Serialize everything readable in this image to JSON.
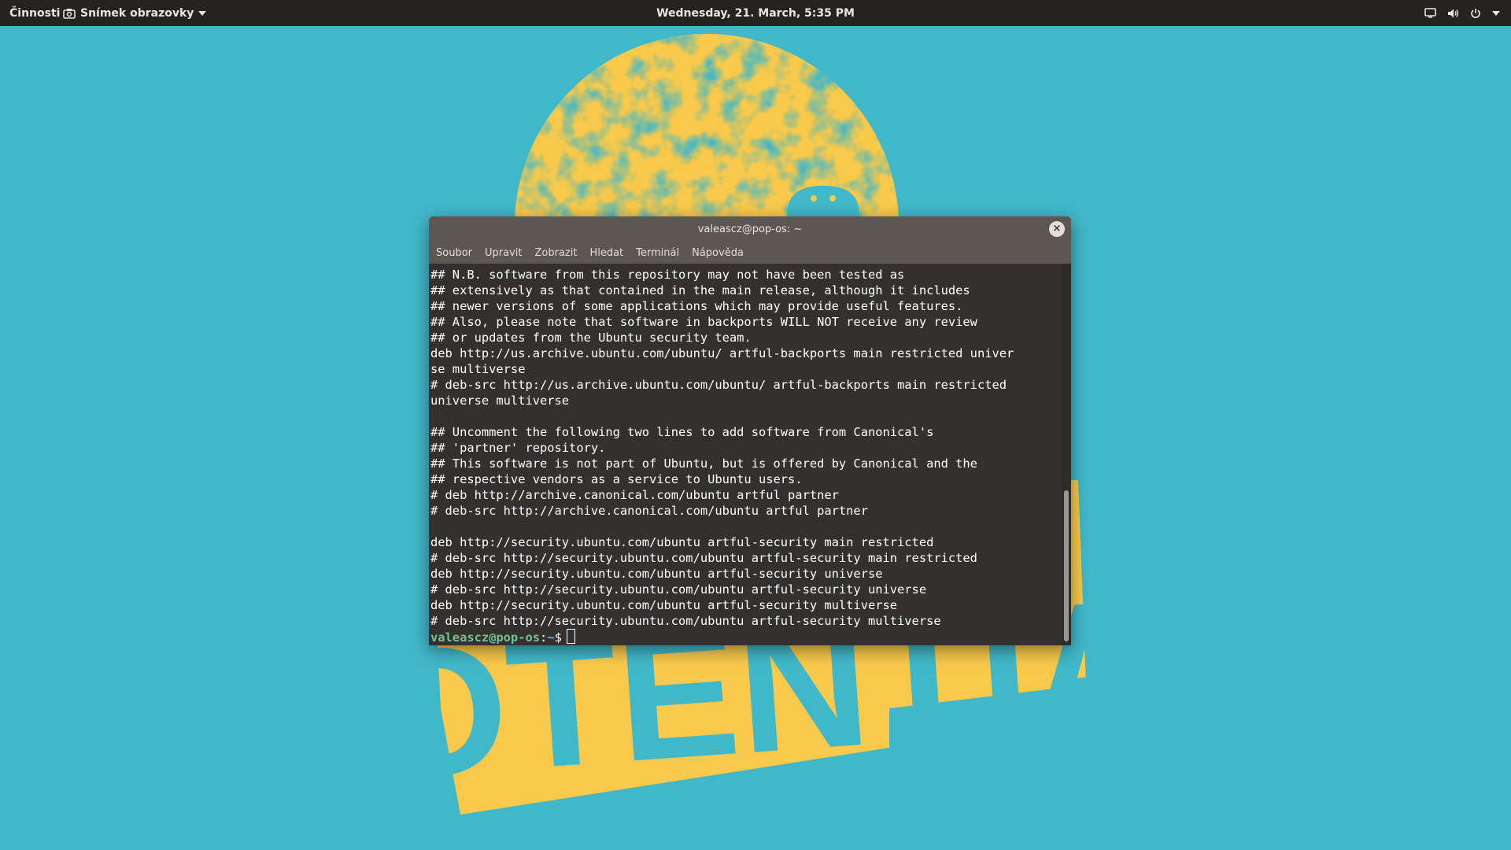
{
  "topbar": {
    "activities": "Činnosti",
    "app_menu_label": "Snímek obrazovky",
    "clock": "Wednesday, 21. March,  5:35 PM"
  },
  "wallpaper": {
    "text": "POTENTIAL",
    "colors": {
      "background": "#41b8c9",
      "accent": "#f8c94a"
    }
  },
  "terminal": {
    "title": "valeascz@pop-os: ~",
    "close_glyph": "×",
    "menu": [
      "Soubor",
      "Upravit",
      "Zobrazit",
      "Hledat",
      "Terminál",
      "Nápověda"
    ],
    "lines": [
      "## N.B. software from this repository may not have been tested as",
      "## extensively as that contained in the main release, although it includes",
      "## newer versions of some applications which may provide useful features.",
      "## Also, please note that software in backports WILL NOT receive any review",
      "## or updates from the Ubuntu security team.",
      "deb http://us.archive.ubuntu.com/ubuntu/ artful-backports main restricted univer",
      "se multiverse",
      "# deb-src http://us.archive.ubuntu.com/ubuntu/ artful-backports main restricted",
      "universe multiverse",
      "",
      "## Uncomment the following two lines to add software from Canonical's",
      "## 'partner' repository.",
      "## This software is not part of Ubuntu, but is offered by Canonical and the",
      "## respective vendors as a service to Ubuntu users.",
      "# deb http://archive.canonical.com/ubuntu artful partner",
      "# deb-src http://archive.canonical.com/ubuntu artful partner",
      "",
      "deb http://security.ubuntu.com/ubuntu artful-security main restricted",
      "# deb-src http://security.ubuntu.com/ubuntu artful-security main restricted",
      "deb http://security.ubuntu.com/ubuntu artful-security universe",
      "# deb-src http://security.ubuntu.com/ubuntu artful-security universe",
      "deb http://security.ubuntu.com/ubuntu artful-security multiverse",
      "# deb-src http://security.ubuntu.com/ubuntu artful-security multiverse"
    ],
    "prompt": {
      "user_host": "valeascz@pop-os",
      "separator": ":",
      "path": "~",
      "symbol": "$"
    }
  }
}
